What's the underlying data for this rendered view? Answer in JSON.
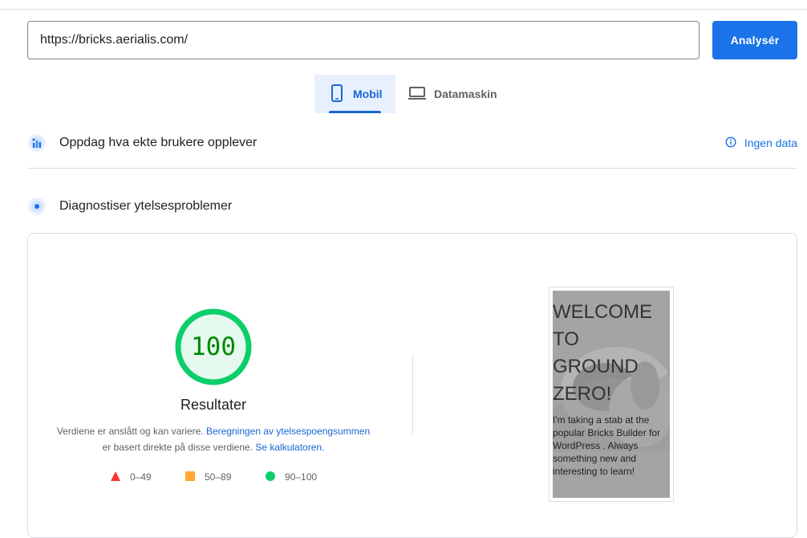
{
  "search": {
    "url_value": "https://bricks.aerialis.com/"
  },
  "toolbar": {
    "analyze_label": "Analysér"
  },
  "tabs": [
    {
      "label": "Mobil",
      "icon": "smartphone-icon",
      "selected": true
    },
    {
      "label": "Datamaskin",
      "icon": "laptop-icon",
      "selected": false
    }
  ],
  "field_data": {
    "title": "Oppdag hva ekte brukere opplever",
    "no_data_label": "Ingen data",
    "icon": "users-chart-icon"
  },
  "lab_data": {
    "title": "Diagnostiser ytelsesproblemer",
    "icon": "lighthouse-icon"
  },
  "score": {
    "value": "100",
    "fraction": 1.0,
    "label": "Resultater",
    "color": "#0cce6b",
    "text_color": "#008800"
  },
  "description": {
    "part1": "Verdiene er anslått og kan variere.",
    "link1": "Beregningen av ytelsespoengsummen",
    "part2": "er basert direkte på disse verdiene.",
    "link2": "Se kalkulatoren."
  },
  "legend": [
    {
      "range": "0–49",
      "shape": "triangle",
      "color": "#ff3333"
    },
    {
      "range": "50–89",
      "shape": "square",
      "color": "#ffaa33"
    },
    {
      "range": "90–100",
      "shape": "circle",
      "color": "#0cce6b"
    }
  ],
  "screenshot": {
    "heading": "WELCOME TO GROUND ZERO!",
    "body": "I'm taking a stab at the popular Bricks Builder for WordPress . Always something new and interesting to learn!"
  },
  "colors": {
    "accent": "#1a73e8",
    "tab_bg": "#e8f0fe"
  }
}
